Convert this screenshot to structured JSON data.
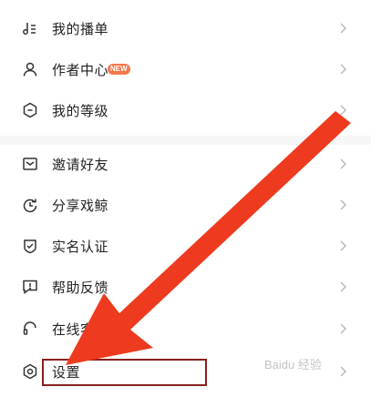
{
  "menu": {
    "items": [
      {
        "label": "我的播单",
        "icon": "music-list-icon"
      },
      {
        "label": "作者中心",
        "icon": "person-icon",
        "badge": "NEW"
      },
      {
        "label": "我的等级",
        "icon": "level-hexagon-icon"
      },
      {
        "label": "邀请好友",
        "icon": "mail-icon"
      },
      {
        "label": "分享戏鲸",
        "icon": "share-rotate-icon"
      },
      {
        "label": "实名认证",
        "icon": "shield-check-icon"
      },
      {
        "label": "帮助反馈",
        "icon": "feedback-bubble-icon"
      },
      {
        "label": "在线客服",
        "icon": "headset-icon"
      },
      {
        "label": "设置",
        "icon": "settings-hexagon-icon"
      }
    ]
  },
  "colors": {
    "badge": "#f2784b",
    "arrow": "#ee3b1f",
    "highlight_border": "#8a1f1f"
  },
  "watermark": "Baidu 经验"
}
